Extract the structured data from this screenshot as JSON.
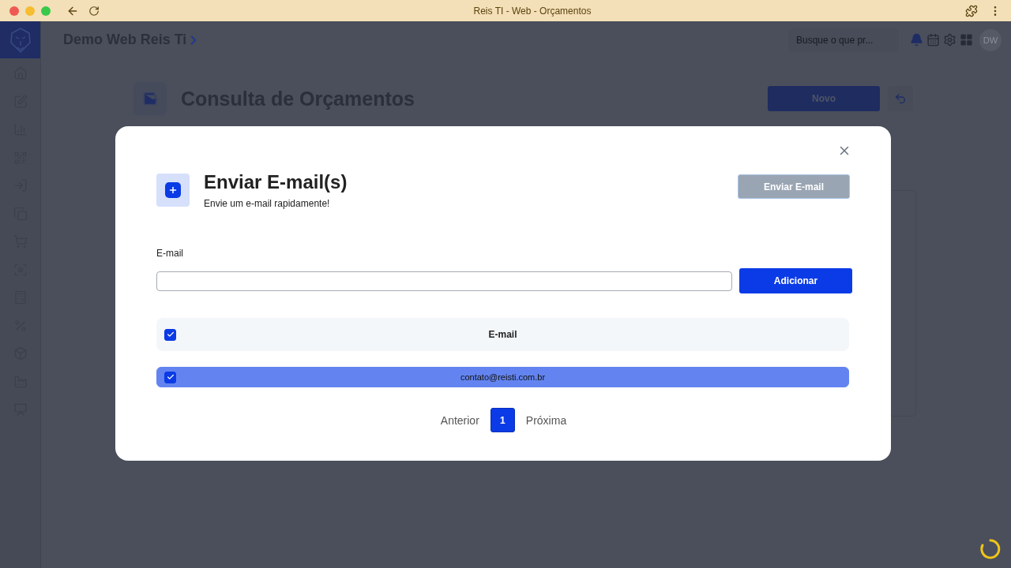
{
  "browser": {
    "title": "Reis TI - Web - Orçamentos"
  },
  "header": {
    "company": "Demo Web Reis Ti",
    "search": {
      "placeholder": "Busque o que pr..."
    },
    "avatar": "DW"
  },
  "page": {
    "title": "Consulta de Orçamentos",
    "new_button": "Novo"
  },
  "modal": {
    "title": "Enviar E-mail(s)",
    "subtitle": "Envie um e-mail rapidamente!",
    "send_button": {
      "label": "Enviar E-mail",
      "disabled": true
    },
    "email_label": "E-mail",
    "add_button": "Adicionar",
    "table": {
      "header": {
        "label": "E-mail",
        "checked": true
      },
      "rows": [
        {
          "email": "contato@reisti.com.br",
          "checked": true,
          "selected": true
        }
      ]
    },
    "pagination": {
      "previous": "Anterior",
      "next": "Próxima",
      "pages": [
        {
          "label": "1",
          "selected": true
        }
      ]
    }
  }
}
